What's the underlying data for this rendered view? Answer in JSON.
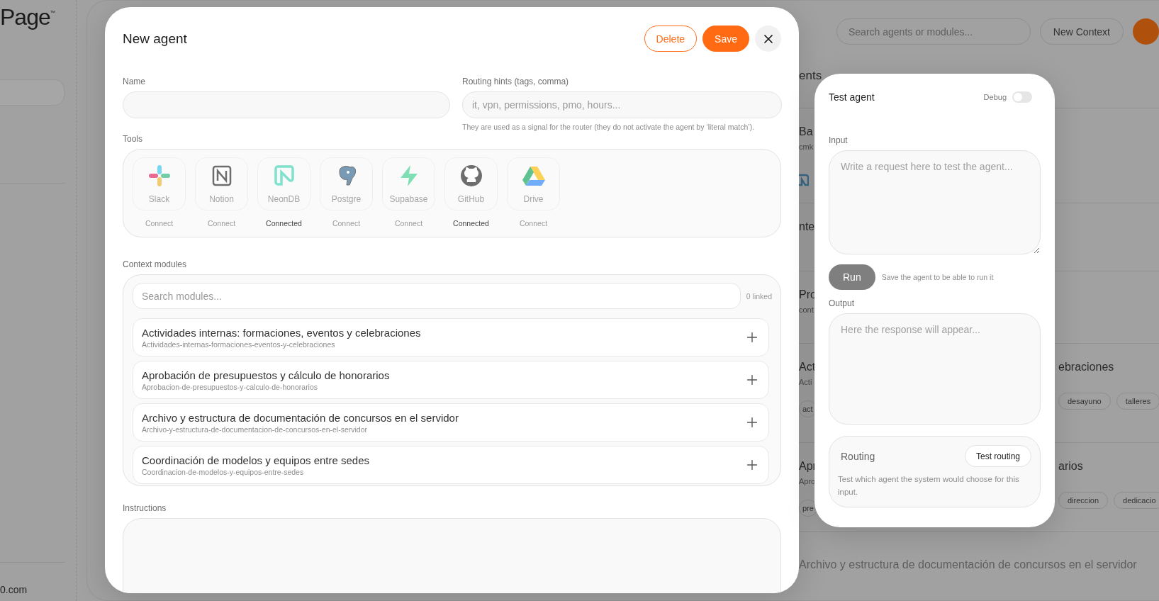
{
  "sidebar": {
    "logo": "Page",
    "logo_mark": "™",
    "footer": "0.com"
  },
  "header": {
    "search": {
      "placeholder": "Search agents or modules..."
    },
    "new_context": "New Context"
  },
  "background_list": {
    "heading": "ents",
    "rows": [
      {
        "kind": "tools",
        "title": "Ba",
        "subtitle": "cmk"
      },
      {
        "kind": "plain",
        "title": "nte"
      },
      {
        "kind": "plain",
        "title": "Pro",
        "subtitle": "cont"
      },
      {
        "kind": "tagged",
        "title": "Act",
        "subtitle": "Acti",
        "tags": [
          "act"
        ],
        "right_title": "ebraciones",
        "right_tags": [
          "desayuno",
          "talleres"
        ]
      },
      {
        "kind": "tagged",
        "title": "Apr",
        "subtitle": "Apro",
        "tags": [
          "pre"
        ],
        "right_title": "arios",
        "right_tags": [
          "direccion",
          "dedicacio"
        ]
      }
    ],
    "faded_title": "Archivo y estructura de documentación de concursos en el servidor"
  },
  "agent_modal": {
    "title": "New agent",
    "delete": "Delete",
    "save": "Save",
    "name_field": {
      "label": "Name"
    },
    "routing_field": {
      "label": "Routing hints (tags, comma)",
      "placeholder": "it, vpn, permissions, pmo, hours...",
      "hint": "They are used as a signal for the router (they do not activate the agent by ‘literal match’)."
    },
    "tools": {
      "label": "Tools",
      "items": [
        {
          "kind": "slack",
          "name": "Slack",
          "status": "Connect",
          "connected": false
        },
        {
          "kind": "notion",
          "name": "Notion",
          "status": "Connect",
          "connected": false
        },
        {
          "kind": "neon",
          "name": "NeonDB",
          "status": "Connected",
          "connected": true
        },
        {
          "kind": "postgres",
          "name": "Postgre",
          "status": "Connect",
          "connected": false
        },
        {
          "kind": "supabase",
          "name": "Supabase",
          "status": "Connect",
          "connected": false
        },
        {
          "kind": "github",
          "name": "GitHub",
          "status": "Connected",
          "connected": true
        },
        {
          "kind": "drive",
          "name": "Drive",
          "status": "Connect",
          "connected": false
        }
      ]
    },
    "context_modules": {
      "label": "Context modules",
      "search_placeholder": "Search modules...",
      "linked": "0 linked",
      "modules": [
        {
          "title": "Actividades internas: formaciones, eventos y celebraciones",
          "slug": "Actividades-internas-formaciones-eventos-y-celebraciones"
        },
        {
          "title": "Aprobación de presupuestos y cálculo de honorarios",
          "slug": "Aprobacion-de-presupuestos-y-calculo-de-honorarios"
        },
        {
          "title": "Archivo y estructura de documentación de concursos en el servidor",
          "slug": "Archivo-y-estructura-de-documentacion-de-concursos-en-el-servidor"
        },
        {
          "title": "Coordinación de modelos y equipos entre sedes",
          "slug": "Coordinacion-de-modelos-y-equipos-entre-sedes"
        }
      ]
    },
    "instructions": {
      "label": "Instructions"
    }
  },
  "test_panel": {
    "title": "Test agent",
    "debug": {
      "label": "Debug",
      "on": false
    },
    "input": {
      "label": "Input",
      "placeholder": "Write a request here to test the agent..."
    },
    "run": {
      "label": "Run",
      "disabled": true
    },
    "run_hint": "Save the agent to be able to run it",
    "output": {
      "label": "Output",
      "placeholder": "Here the response will appear..."
    },
    "routing": {
      "title": "Routing",
      "button": "Test routing",
      "description": "Test which agent the system would choose for this input."
    }
  }
}
